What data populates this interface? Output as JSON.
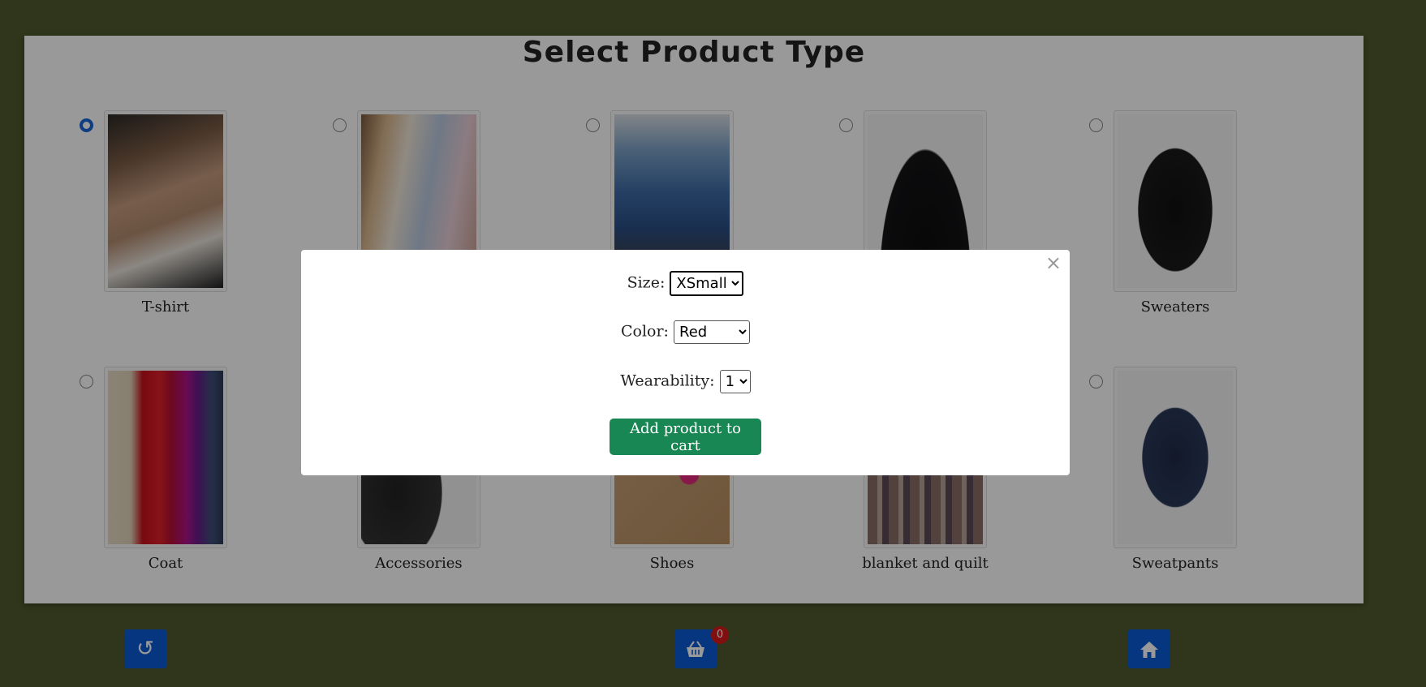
{
  "page": {
    "title": "Select Product Type"
  },
  "products": [
    {
      "label": "T-shirt",
      "selected": true,
      "image": "tshirt-stack"
    },
    {
      "label": "",
      "selected": false,
      "image": "shirts-on-hangers"
    },
    {
      "label": "",
      "selected": false,
      "image": "jeans-stack"
    },
    {
      "label": "",
      "selected": false,
      "image": "black-skirt"
    },
    {
      "label": "Sweaters",
      "selected": false,
      "image": "black-hoodie"
    },
    {
      "label": "Coat",
      "selected": false,
      "image": "puffer-coats"
    },
    {
      "label": "Accessories",
      "selected": false,
      "image": "hat-and-gloves"
    },
    {
      "label": "Shoes",
      "selected": false,
      "image": "sneakers"
    },
    {
      "label": "blanket and quilt",
      "selected": false,
      "image": "blanket"
    },
    {
      "label": "Sweatpants",
      "selected": false,
      "image": "sweatpants"
    }
  ],
  "modal": {
    "close_label": "×",
    "size_label": "Size:",
    "size_value": "XSmall",
    "color_label": "Color:",
    "color_value": "Red",
    "wearability_label": "Wearability:",
    "wearability_value": "1",
    "add_button_label": "Add product to cart"
  },
  "bottom_bar": {
    "back_icon": "rotate-left-icon",
    "cart_icon": "basket-icon",
    "cart_count": "0",
    "home_icon": "home-icon"
  },
  "colors": {
    "background": "#4f5a2d",
    "accent": "#0d5bd7",
    "button_green": "#198754",
    "badge_red": "#d91a1a"
  }
}
